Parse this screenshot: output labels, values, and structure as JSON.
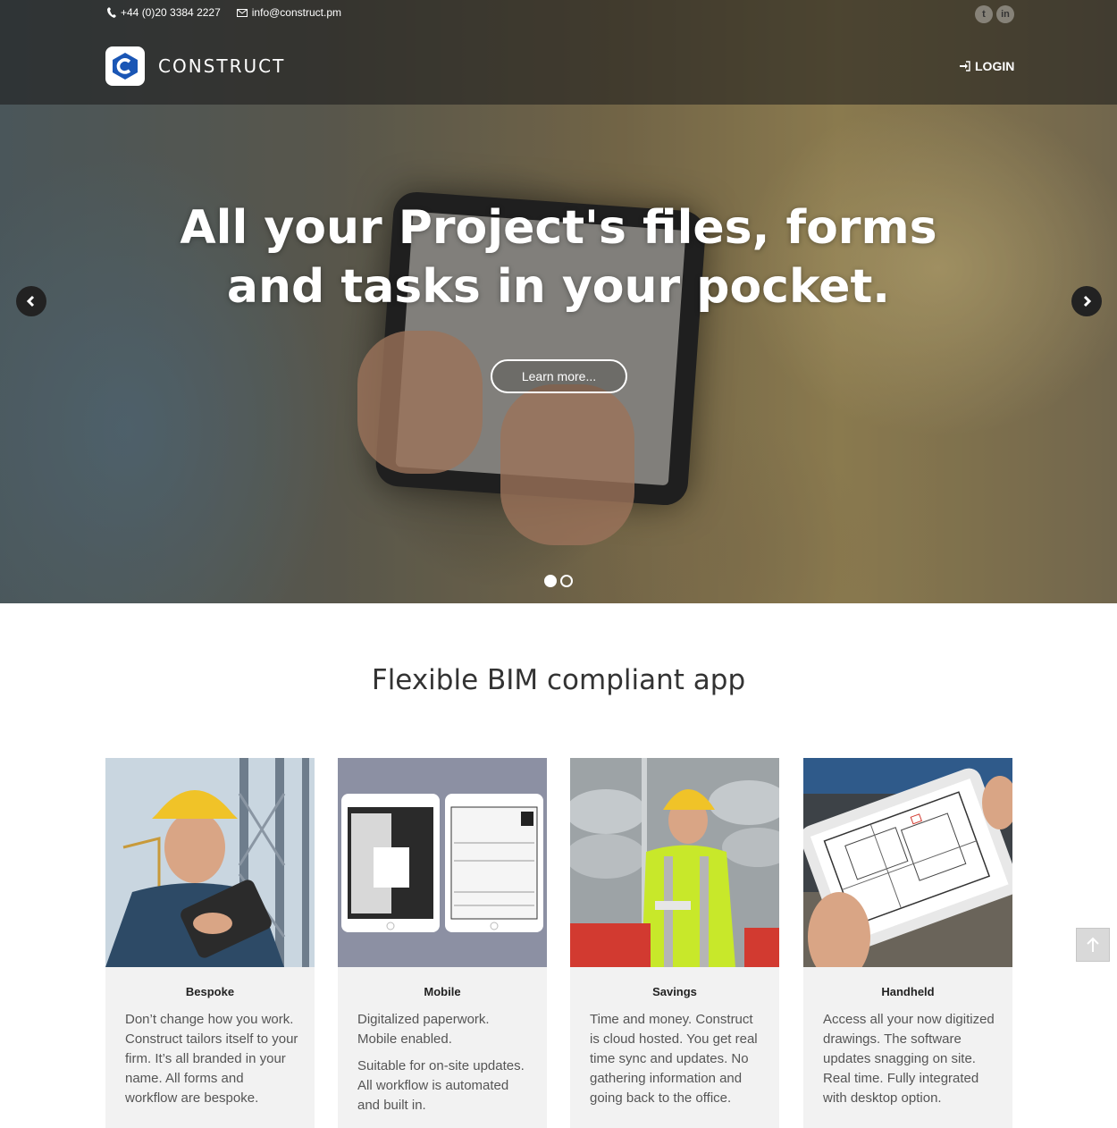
{
  "topbar": {
    "phone": "+44 (0)20 3384 2227",
    "email": "info@construct.pm",
    "social": [
      {
        "icon": "twitter-icon",
        "glyph": "t"
      },
      {
        "icon": "linkedin-icon",
        "glyph": "in"
      }
    ]
  },
  "brand": {
    "name": "CONSTRUCT",
    "logo_letter": "C",
    "logo_color": "#1a56b5"
  },
  "nav": {
    "login_label": "LOGIN"
  },
  "hero": {
    "headline_line1": "All your Project's files, forms",
    "headline_line2": "and tasks in your pocket.",
    "cta_label": "Learn more...",
    "slides_total": 2,
    "active_slide": 1
  },
  "features": {
    "title": "Flexible BIM compliant app",
    "cards": [
      {
        "title": "Bespoke",
        "paragraphs": [
          "Don’t change how you work. Construct tailors itself to your firm. It’s all branded in your name. All forms and workflow are bespoke."
        ]
      },
      {
        "title": "Mobile",
        "paragraphs": [
          "Digitalized paperwork. Mobile enabled.",
          "Suitable for on-site updates. All workflow is automated and built in."
        ]
      },
      {
        "title": "Savings",
        "paragraphs": [
          "Time and money. Construct is cloud hosted. You get real time sync and updates. No gathering information and going back to the office."
        ]
      },
      {
        "title": "Handheld",
        "paragraphs": [
          "Access all your now digitized drawings. The software updates snagging on site. Real time. Fully integrated with desktop option."
        ]
      }
    ]
  },
  "colors": {
    "accent": "#1a56b5",
    "card_bg": "#f2f2f2"
  }
}
